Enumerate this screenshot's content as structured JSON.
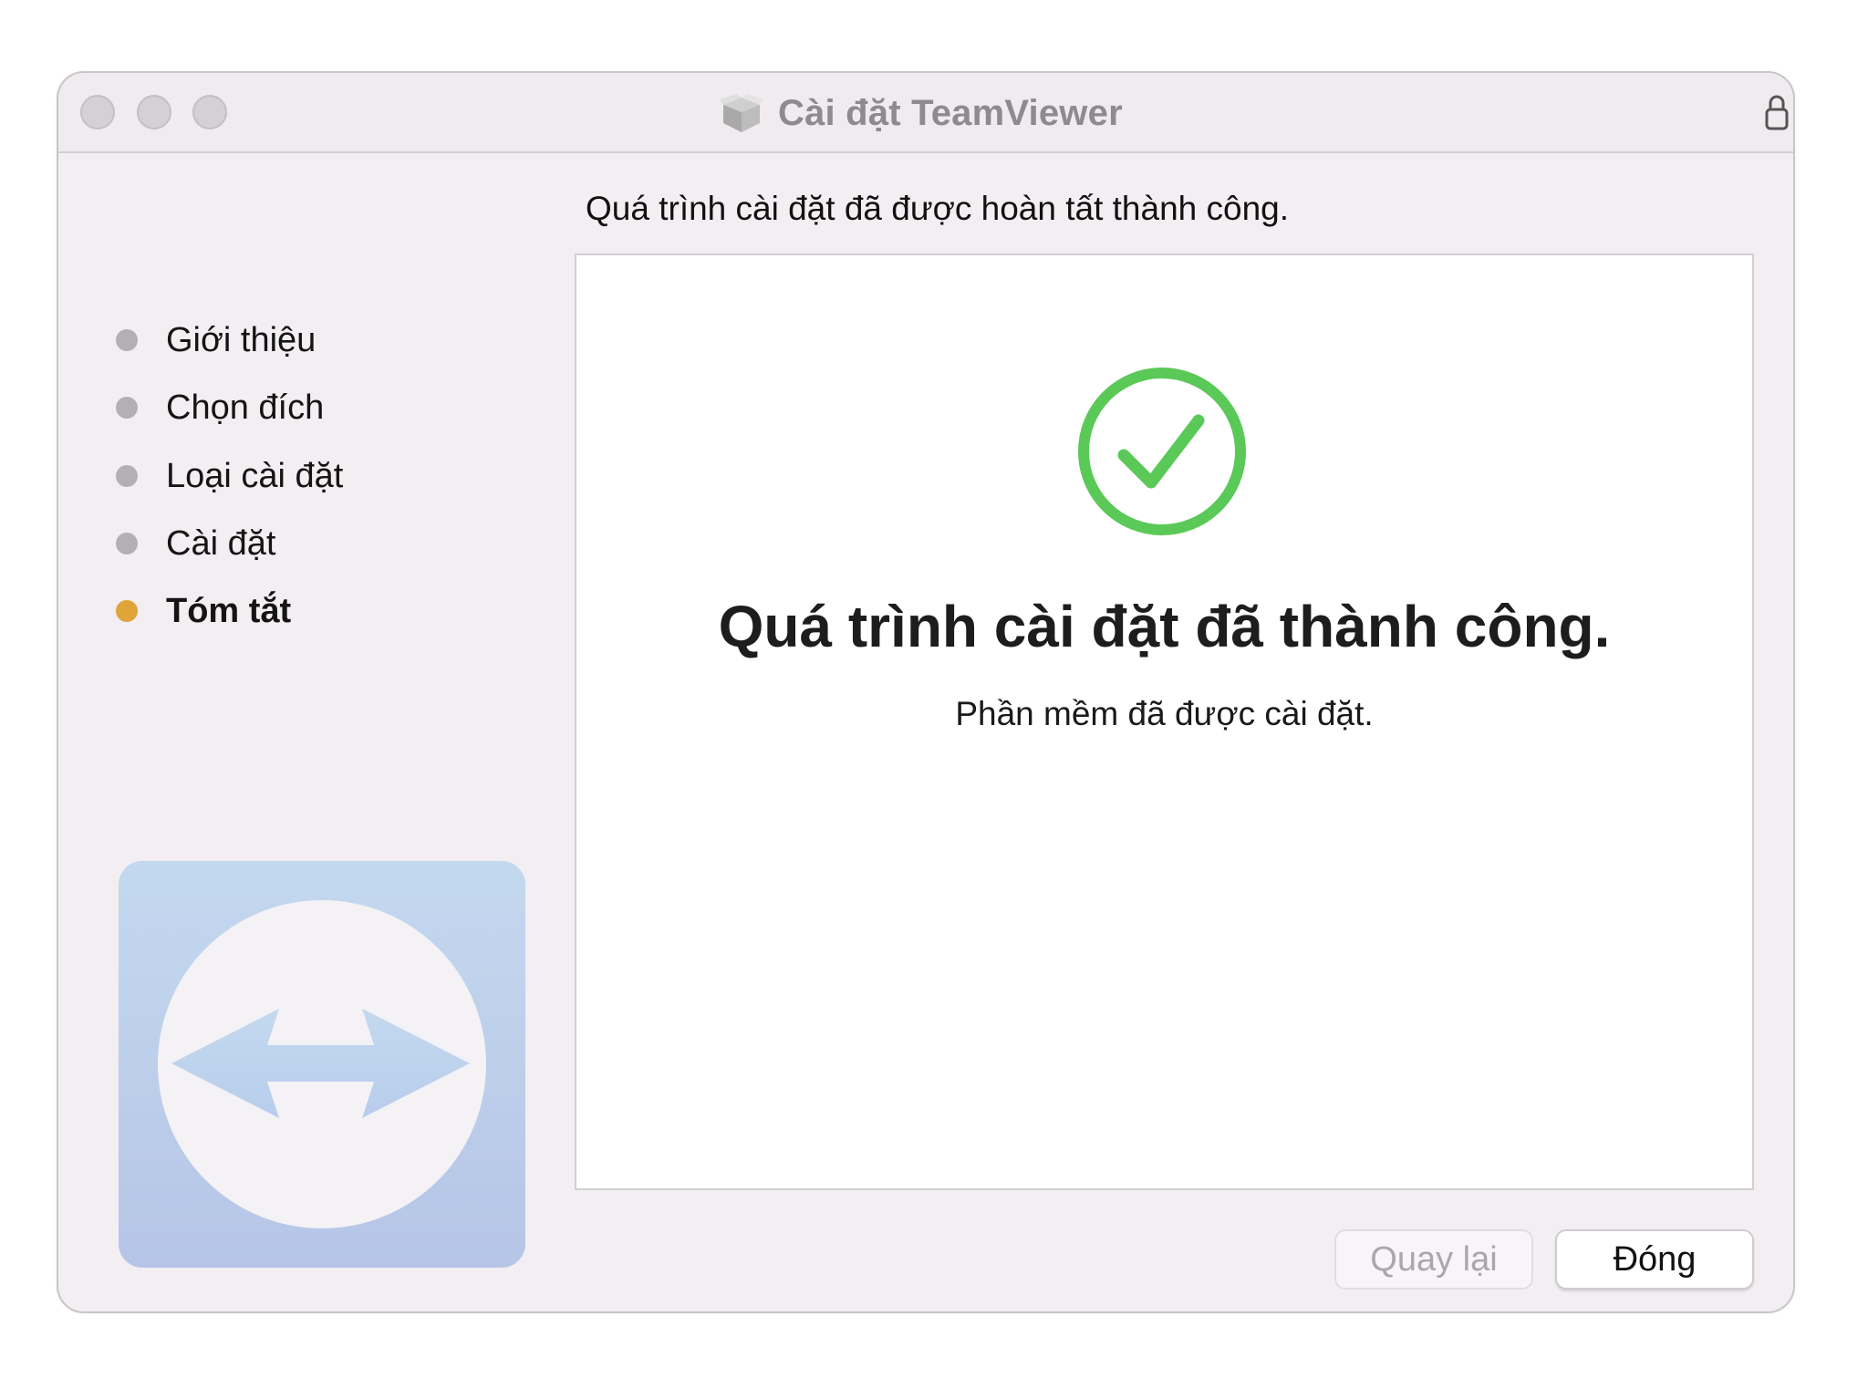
{
  "window": {
    "title": "Cài đặt TeamViewer",
    "title_icon": "package-icon",
    "lock_icon": "lock-icon",
    "traffic_lights": [
      "close",
      "minimize",
      "zoom"
    ]
  },
  "heading": "Quá trình cài đặt đã được hoàn tất thành công.",
  "steps": [
    {
      "label": "Giới thiệu",
      "state": "done"
    },
    {
      "label": "Chọn đích",
      "state": "done"
    },
    {
      "label": "Loại cài đặt",
      "state": "done"
    },
    {
      "label": "Cài đặt",
      "state": "done"
    },
    {
      "label": "Tóm tắt",
      "state": "current"
    }
  ],
  "colors": {
    "step_inactive": "#b3b0b3",
    "step_active": "#dfa43a",
    "success": "#5ac957",
    "logo_blue": "#b9d2ef"
  },
  "panel": {
    "status_icon": "checkmark-circle-icon",
    "title": "Quá trình cài đặt đã thành công.",
    "subtitle": "Phần mềm đã được cài đặt."
  },
  "buttons": {
    "back_label": "Quay lại",
    "back_enabled": false,
    "close_label": "Đóng"
  },
  "logo": "teamviewer-logo-icon"
}
